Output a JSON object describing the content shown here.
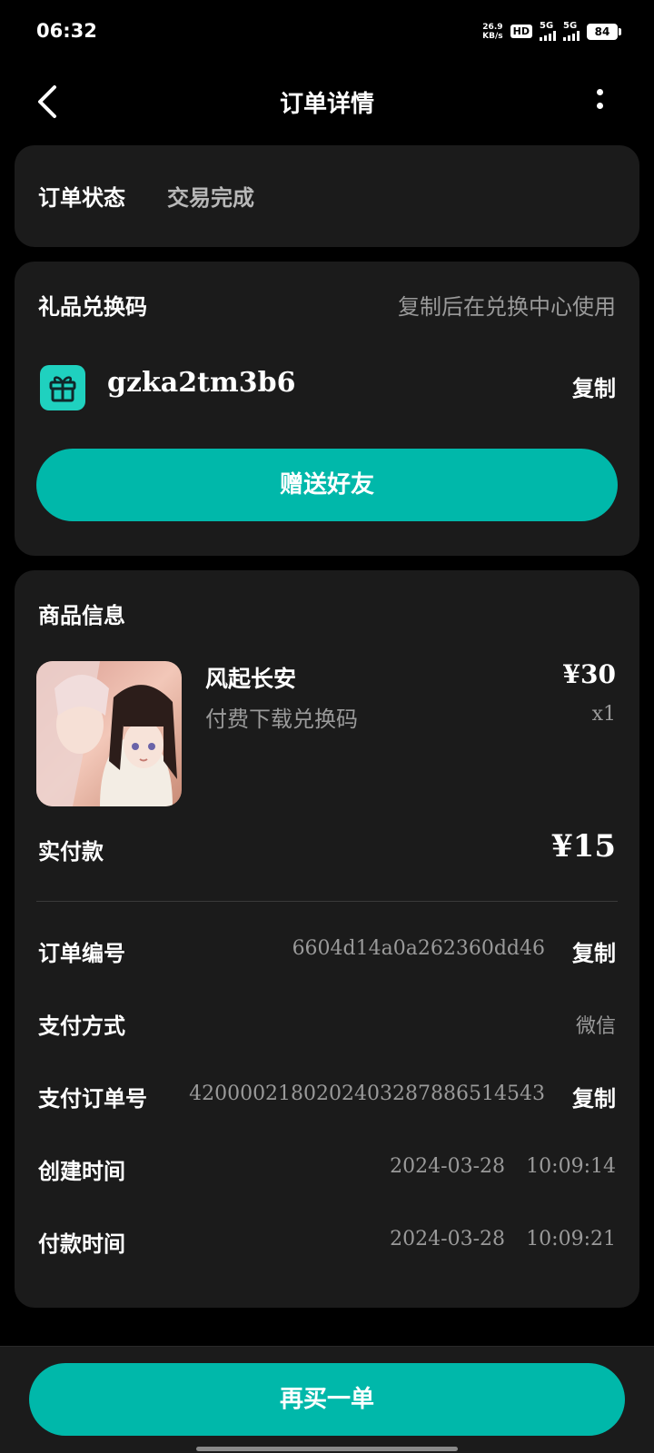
{
  "status_bar": {
    "time": "06:32",
    "net_speed_value": "26.9",
    "net_speed_unit": "KB/s",
    "hd_label": "HD",
    "sim1_label": "5G",
    "sim2_label": "5G",
    "battery": "84"
  },
  "header": {
    "title": "订单详情",
    "back_icon": "chevron-left-icon",
    "more_icon": "more-vertical-icon"
  },
  "order_status": {
    "label": "订单状态",
    "value": "交易完成"
  },
  "gift": {
    "title": "礼品兑换码",
    "hint": "复制后在兑换中心使用",
    "icon": "gift-icon",
    "code": "gzka2tm3b6",
    "copy_label": "复制",
    "send_button": "赠送好友"
  },
  "product": {
    "section_title": "商品信息",
    "name": "风起长安",
    "price": "¥30",
    "type": "付费下载兑换码",
    "quantity": "x1",
    "paid_label": "实付款",
    "paid_value": "¥15"
  },
  "details": {
    "order_no_label": "订单编号",
    "order_no": "6604d14a0a262360dd46",
    "order_no_copy": "复制",
    "pay_method_label": "支付方式",
    "pay_method": "微信",
    "pay_order_label": "支付订单号",
    "pay_order_no": "4200002180202403287886514543",
    "pay_order_copy": "复制",
    "created_label": "创建时间",
    "created_date": "2024-03-28",
    "created_time": "10:09:14",
    "paid_time_label": "付款时间",
    "paid_date": "2024-03-28",
    "paid_time": "10:09:21"
  },
  "bottom": {
    "rebuy_button": "再买一单"
  },
  "colors": {
    "accent": "#00b8aa",
    "card": "#1b1b1b",
    "background": "#000000",
    "muted_text": "#9a9a9a"
  }
}
